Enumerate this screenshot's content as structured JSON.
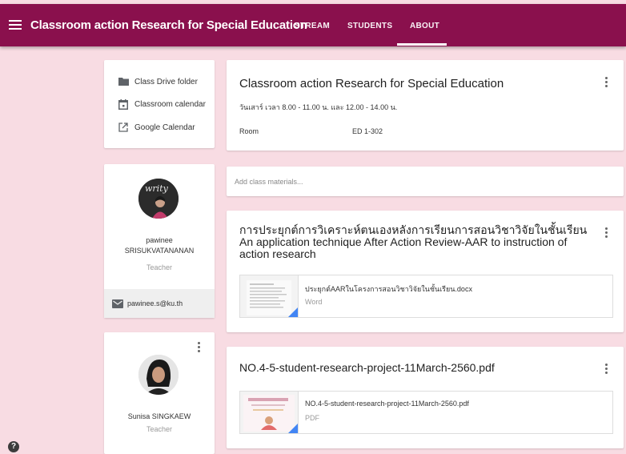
{
  "header": {
    "title": "Classroom action Research for Special Education",
    "tabs": [
      {
        "label": "STREAM"
      },
      {
        "label": "STUDENTS"
      },
      {
        "label": "ABOUT"
      }
    ],
    "selected_tab": "ABOUT",
    "bar_color": "#8a104d"
  },
  "links": [
    {
      "label": "Class Drive folder",
      "icon": "folder-icon"
    },
    {
      "label": "Classroom calendar",
      "icon": "calendar-icon"
    },
    {
      "label": "Google Calendar",
      "icon": "open-in-new-icon"
    }
  ],
  "about": {
    "title": "Classroom action Research for Special Education",
    "schedule": "วันเสาร์ เวลา 8.00 - 11.00 น. และ 12.00 - 14.00 น.",
    "room_label": "Room",
    "room_value": "ED 1-302"
  },
  "materials": {
    "placeholder": "Add class materials..."
  },
  "teachers": [
    {
      "name_line1": "pawinee",
      "name_line2": "SRISUKVATANANAN",
      "role": "Teacher",
      "email": "pawinee.s@ku.th"
    },
    {
      "name_line1": "Sunisa SINGKAEW",
      "role": "Teacher"
    }
  ],
  "posts": [
    {
      "title": "การประยุกต์การวิเคราะห์ตนเองหลังการเรียนการสอนวิชาวิจัยในชั้นเรียน An application technique After Action Review-AAR to instruction of action research",
      "attachment": {
        "name": "ประยุกต์AARในโครงการสอนวิชาวิจัยในชั้นเรียน.docx",
        "type": "Word"
      }
    },
    {
      "title": "NO.4-5-student-research-project-11March-2560.pdf",
      "attachment": {
        "name": "NO.4-5-student-research-project-11March-2560.pdf",
        "type": "PDF"
      }
    }
  ],
  "colors": {
    "background": "#f8dce3",
    "accent": "#4285f4"
  }
}
